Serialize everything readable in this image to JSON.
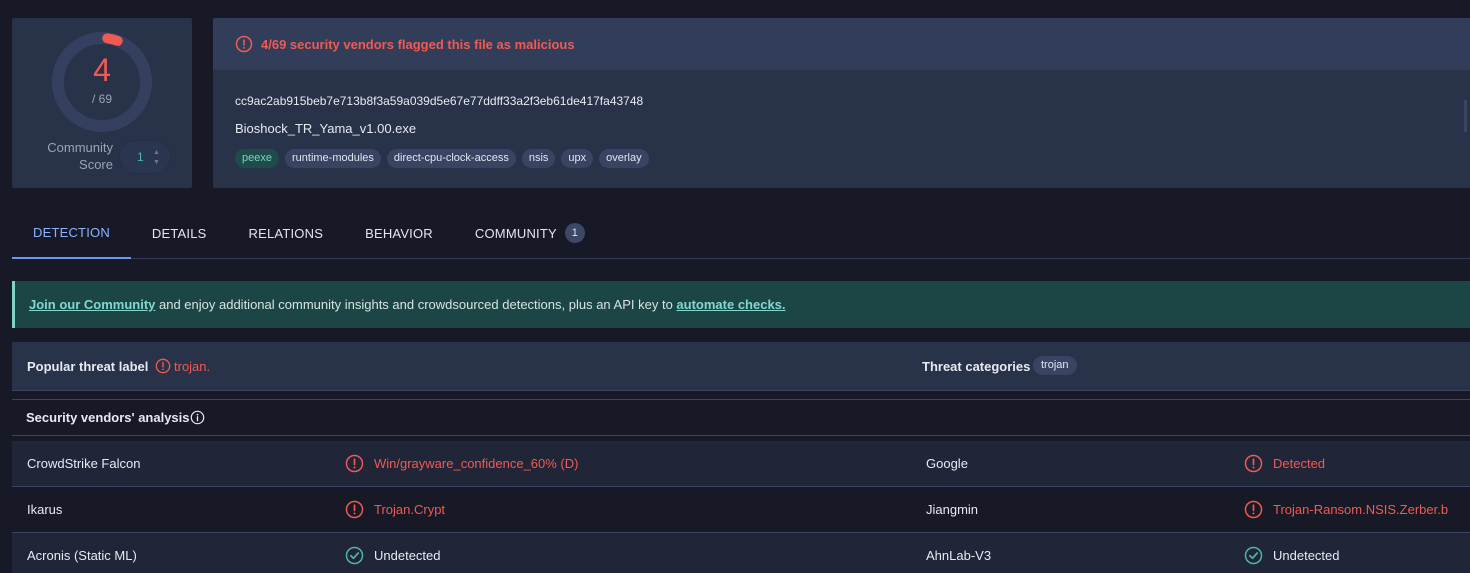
{
  "score": {
    "detections": "4",
    "total": "/ 69",
    "detection_ratio": 0.058,
    "community_label": "Community Score",
    "community_value": "1"
  },
  "file": {
    "alert": "4/69 security vendors flagged this file as malicious",
    "hash": "cc9ac2ab915beb7e713b8f3a59a039d5e67e77ddff33a2f3eb61de417fa43748",
    "name": "Bioshock_TR_Yama_v1.00.exe",
    "tags": [
      "peexe",
      "runtime-modules",
      "direct-cpu-clock-access",
      "nsis",
      "upx",
      "overlay"
    ]
  },
  "tabs": [
    {
      "label": "DETECTION",
      "active": true
    },
    {
      "label": "DETAILS"
    },
    {
      "label": "RELATIONS"
    },
    {
      "label": "BEHAVIOR"
    },
    {
      "label": "COMMUNITY",
      "badge": "1"
    }
  ],
  "banner": {
    "link1": "Join our Community",
    "text": " and enjoy additional community insights and crowdsourced detections, plus an API key to ",
    "link2": "automate checks."
  },
  "threat": {
    "label_title": "Popular threat label",
    "label_value": "trojan.",
    "categories_title": "Threat categories",
    "categories": [
      "trojan"
    ]
  },
  "analysis": {
    "title": "Security vendors' analysis",
    "rows": [
      [
        {
          "vendor": "CrowdStrike Falcon",
          "result": "Win/grayware_confidence_60% (D)",
          "status": "detected"
        },
        {
          "vendor": "Google",
          "result": "Detected",
          "status": "detected"
        }
      ],
      [
        {
          "vendor": "Ikarus",
          "result": "Trojan.Crypt",
          "status": "detected"
        },
        {
          "vendor": "Jiangmin",
          "result": "Trojan-Ransom.NSIS.Zerber.b",
          "status": "detected"
        }
      ],
      [
        {
          "vendor": "Acronis (Static ML)",
          "result": "Undetected",
          "status": "undetected"
        },
        {
          "vendor": "AhnLab-V3",
          "result": "Undetected",
          "status": "undetected"
        }
      ]
    ]
  },
  "colors": {
    "malicious": "#f05a52",
    "clean": "#4fb6a5",
    "accent": "#6f94f5"
  }
}
